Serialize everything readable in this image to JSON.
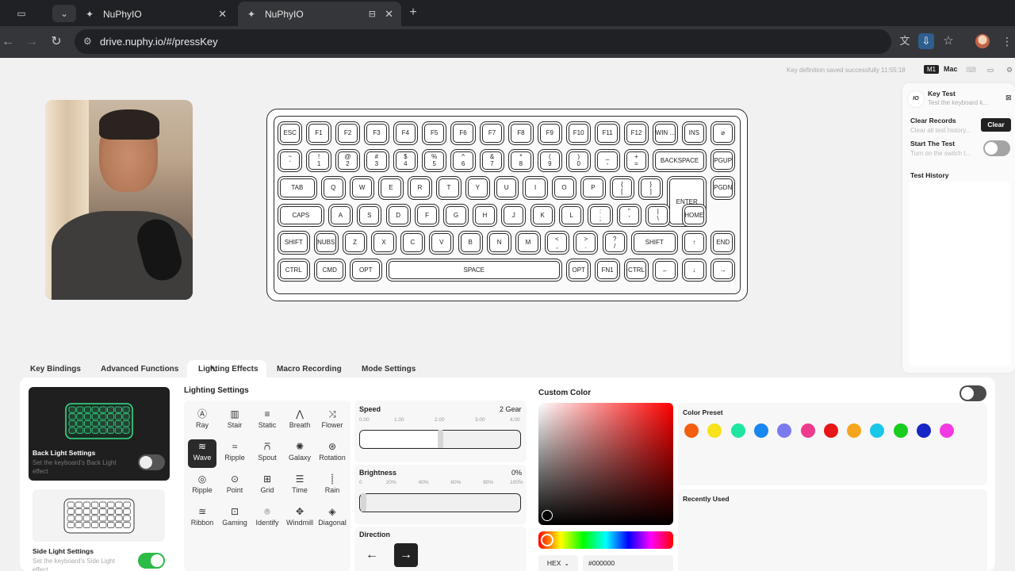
{
  "browser": {
    "tabs": [
      {
        "title": "NuPhyIO",
        "active": false
      },
      {
        "title": "NuPhyIO",
        "active": true
      }
    ],
    "url": "drive.nuphy.io/#/pressKey"
  },
  "status": {
    "message": "Key definition saved successfully 11:55:18",
    "badge_m1": "M1",
    "badge_os": "Mac"
  },
  "key_test": {
    "title": "Key Test",
    "subtitle": "Test the keyboard k...",
    "logo": "IO",
    "clear_title": "Clear Records",
    "clear_sub": "Clear all test history...",
    "clear_button": "Clear",
    "start_title": "Start The Test",
    "start_sub": "Turn on the switch t...",
    "start_on": false,
    "history_title": "Test History"
  },
  "keyboard": {
    "rows": [
      [
        "ESC",
        "F1",
        "F2",
        "F3",
        "F4",
        "F5",
        "F6",
        "F7",
        "F8",
        "F9",
        "F10",
        "F11",
        "F12",
        "WIN ...",
        "INS",
        "⌀"
      ],
      [
        "~\n`",
        "!\n1",
        "@\n2",
        "#\n3",
        "$\n4",
        "%\n5",
        "^\n6",
        "&\n7",
        "*\n8",
        "(\n9",
        ")\n0",
        "_\n-",
        "+\n=",
        "BACKSPACE",
        "PGUP"
      ],
      [
        "TAB",
        "Q",
        "W",
        "E",
        "R",
        "T",
        "Y",
        "U",
        "I",
        "O",
        "P",
        "{\n[",
        "}\n]",
        "ENTER",
        "PGDN"
      ],
      [
        "CAPS",
        "A",
        "S",
        "D",
        "F",
        "G",
        "H",
        "J",
        "K",
        "L",
        ":\n;",
        "\"\n'",
        "|\n\\",
        "HOME"
      ],
      [
        "SHIFT",
        "NUBS",
        "Z",
        "X",
        "C",
        "V",
        "B",
        "N",
        "M",
        "<\n,",
        ">\n.",
        "?\n/",
        "SHIFT",
        "↑",
        "END"
      ],
      [
        "CTRL",
        "CMD",
        "OPT",
        "SPACE",
        "OPT",
        "FN1",
        "CTRL",
        "←",
        "↓",
        "→"
      ]
    ]
  },
  "bottom_tabs": [
    "Key Bindings",
    "Advanced Functions",
    "Lighting Effects",
    "Macro Recording",
    "Mode Settings"
  ],
  "active_tab": "Lighting Effects",
  "back_light": {
    "title": "Back Light Settings",
    "desc": "Set the keyboard's Back Light effect",
    "on": false
  },
  "side_light": {
    "title": "Side Light Settings",
    "desc": "Set the keyboard's Side Light effect",
    "on": true
  },
  "lighting": {
    "title": "Lighting Settings",
    "effects": [
      {
        "name": "Ray",
        "icon": "Ⓐ"
      },
      {
        "name": "Stair",
        "icon": "▥"
      },
      {
        "name": "Static",
        "icon": "≡"
      },
      {
        "name": "Breath",
        "icon": "⋀"
      },
      {
        "name": "Flower",
        "icon": "⤨"
      },
      {
        "name": "Wave",
        "icon": "≋"
      },
      {
        "name": "Ripple",
        "icon": "≈"
      },
      {
        "name": "Spout",
        "icon": "⩃"
      },
      {
        "name": "Galaxy",
        "icon": "✺"
      },
      {
        "name": "Rotation",
        "icon": "⊛"
      },
      {
        "name": "Ripple",
        "icon": "◎"
      },
      {
        "name": "Point",
        "icon": "⊙"
      },
      {
        "name": "Grid",
        "icon": "⊞"
      },
      {
        "name": "Time",
        "icon": "☰"
      },
      {
        "name": "Rain",
        "icon": "⸽"
      },
      {
        "name": "Ribbon",
        "icon": "≊"
      },
      {
        "name": "Gaming",
        "icon": "⊡"
      },
      {
        "name": "Identify",
        "icon": "⌾"
      },
      {
        "name": "Windmill",
        "icon": "✥"
      },
      {
        "name": "Diagonal",
        "icon": "◈"
      }
    ],
    "selected": "Wave"
  },
  "speed": {
    "label": "Speed",
    "value": "2 Gear",
    "ticks": [
      "0.00",
      "1.00",
      "2.00",
      "3.00",
      "4.00"
    ],
    "level": 2
  },
  "brightness": {
    "label": "Brightness",
    "value": "0%",
    "ticks": [
      "0",
      "20%",
      "40%",
      "60%",
      "80%",
      "100%"
    ],
    "level": 0
  },
  "direction": {
    "label": "Direction",
    "left": "←",
    "right": "→",
    "selected": "right"
  },
  "custom_color": {
    "title": "Custom Color",
    "on": false,
    "preset_title": "Color Preset",
    "presets": [
      "#f2600f",
      "#f7e21b",
      "#1ee6a0",
      "#1a86f0",
      "#7b7bef",
      "#ef3b8e",
      "#e81616",
      "#f6a61e",
      "#19c7e8",
      "#18cd1e",
      "#1727c6",
      "#f23ae2"
    ],
    "recent_title": "Recently Used",
    "format": "HEX",
    "hex_value": "#000000"
  }
}
